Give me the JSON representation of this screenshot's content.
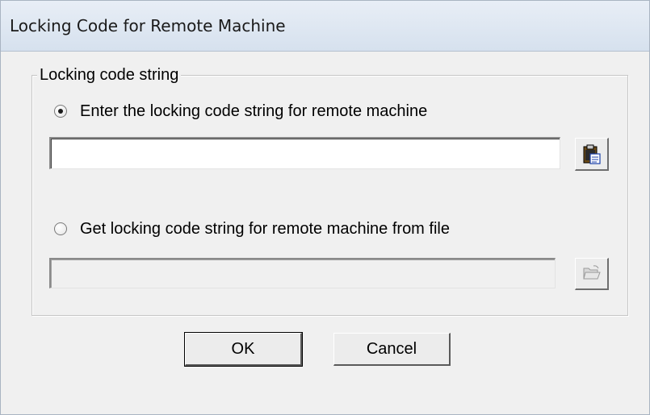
{
  "window": {
    "title": "Locking Code for Remote Machine"
  },
  "group": {
    "legend": "Locking code string"
  },
  "option_enter": {
    "label": "Enter the locking code string for remote machine",
    "selected": true,
    "input_value": "",
    "paste_icon": "paste-clipboard-icon"
  },
  "option_file": {
    "label": "Get locking code string for remote machine from file",
    "selected": false,
    "input_value": "",
    "browse_icon": "open-folder-icon",
    "enabled": false
  },
  "buttons": {
    "ok_label": "OK",
    "cancel_label": "Cancel"
  }
}
